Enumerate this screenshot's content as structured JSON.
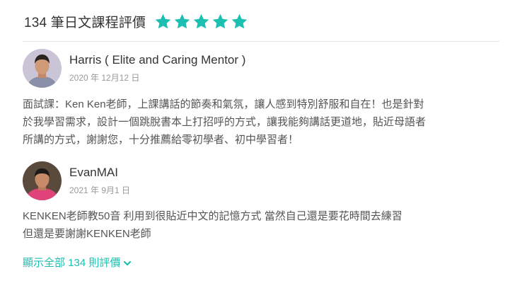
{
  "header": {
    "title": "134 筆日文課程評價",
    "rating": 5,
    "star_color": "#1cbfb0"
  },
  "reviews": [
    {
      "name": "Harris ( Elite and Caring Mentor )",
      "date": "2020 年 12月12 日",
      "lines": [
        "面試課：Ken Ken老師，上課講話的節奏和氣氛，讓人感到特別舒服和自在！也是針對",
        "於我學習需求，設計一個跳脫書本上打招呼的方式，讓我能夠講話更道地，貼近母語者",
        "所講的方式，謝謝您，十分推薦給零初學者、初中學習者！"
      ]
    },
    {
      "name": "EvanMAI",
      "date": "2021 年 9月1 日",
      "lines": [
        "KENKEN老師教50音 利用到很貼近中文的記憶方式 當然自己還是要花時間去練習",
        "但還是要謝謝KENKEN老師"
      ]
    }
  ],
  "footer": {
    "show_all_label": "顯示全部 134 則評價",
    "link_color": "#1cbfb0"
  }
}
